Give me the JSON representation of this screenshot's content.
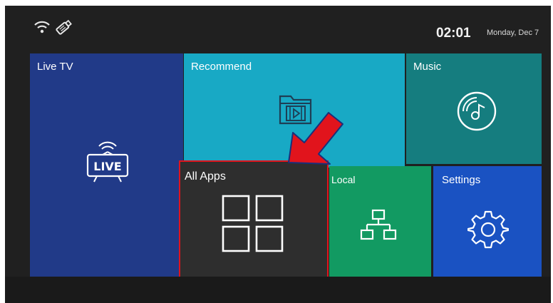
{
  "status_bar": {
    "wifi_icon": "wifi-icon",
    "usb_icon": "usb-drive-icon",
    "time": "02:01",
    "date": "Monday, Dec 7"
  },
  "tiles": {
    "live_tv": {
      "label": "Live TV",
      "icon": "live-tv-icon",
      "color": "#213a88"
    },
    "recommend": {
      "label": "Recommend",
      "icon": "film-folder-icon",
      "color": "#18a9c5"
    },
    "music": {
      "label": "Music",
      "icon": "music-disc-icon",
      "color": "#157d7f"
    },
    "all_apps": {
      "label": "All Apps",
      "icon": "grid-icon",
      "color": "#2e2e2e",
      "highlight": "#e1141c"
    },
    "local": {
      "label": "Local",
      "icon": "network-icon",
      "color": "#129a62"
    },
    "settings": {
      "label": "Settings",
      "icon": "gear-icon",
      "color": "#1a52c2"
    }
  },
  "annotation": {
    "arrow_color": "#e1141c"
  }
}
